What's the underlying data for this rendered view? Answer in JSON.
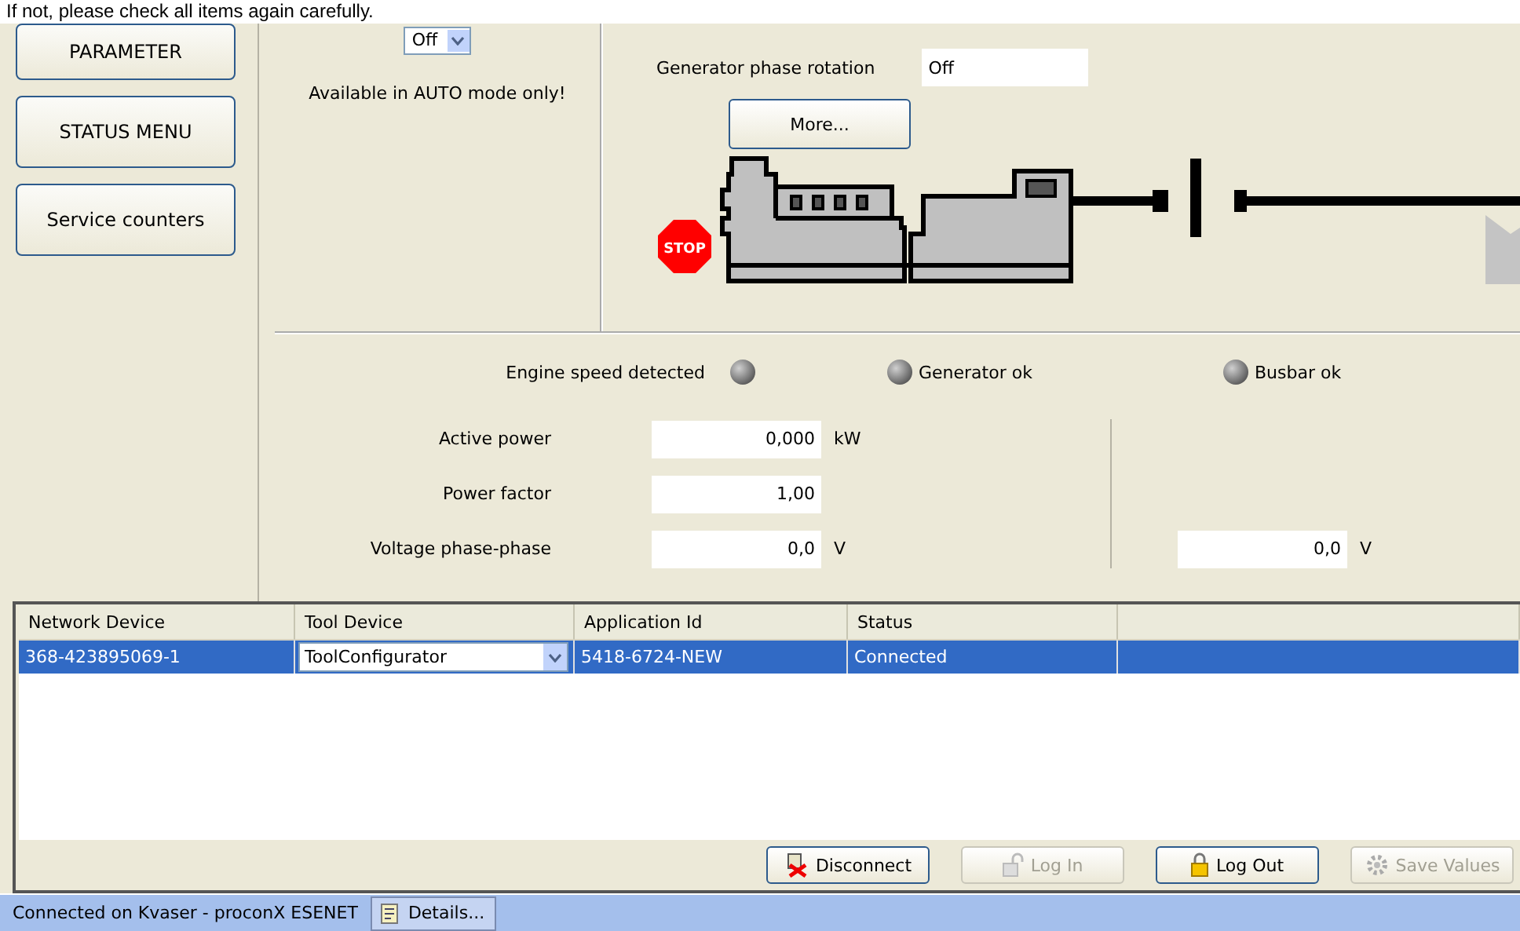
{
  "notice": "If not, please check all items again carefully.",
  "nav": [
    {
      "label": "PARAMETER"
    },
    {
      "label": "STATUS MENU"
    },
    {
      "label": "Service counters"
    }
  ],
  "mode": {
    "value": "Off",
    "note": "Available in AUTO mode only!"
  },
  "phase_rotation": {
    "label": "Generator phase rotation",
    "value": "Off"
  },
  "more_button": "More...",
  "stop_sign": "STOP",
  "indicators": [
    {
      "label": "Engine speed detected",
      "on": false
    },
    {
      "label": "Generator ok",
      "on": false
    },
    {
      "label": "Busbar ok",
      "on": false
    }
  ],
  "measurements": [
    {
      "label": "Active power",
      "value": "0,000",
      "unit": "kW"
    },
    {
      "label": "Power factor",
      "value": "1,00"
    },
    {
      "label": "Voltage phase-phase",
      "value": "0,0",
      "unit": "V",
      "busbar_value": "0,0",
      "busbar_unit": "V"
    }
  ],
  "table": {
    "columns": [
      "Network Device",
      "Tool Device",
      "Application Id",
      "Status"
    ],
    "rows": [
      {
        "network_device": "368-423895069-1",
        "tool_device": "ToolConfigurator",
        "application_id": "5418-6724-NEW",
        "status": "Connected",
        "selected": true
      }
    ]
  },
  "actions": [
    {
      "label": "Disconnect",
      "disabled": false,
      "kind": "disconnect"
    },
    {
      "label": "Log In",
      "disabled": true,
      "kind": "unlock"
    },
    {
      "label": "Log Out",
      "disabled": false,
      "kind": "lock"
    },
    {
      "label": "Save Values",
      "disabled": true,
      "kind": "save"
    }
  ],
  "status_bar": {
    "text": "Connected on Kvaser - proconX ESENET",
    "details": "Details..."
  }
}
